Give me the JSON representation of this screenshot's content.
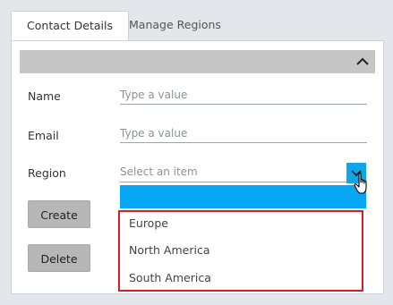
{
  "tabs": [
    {
      "label": "Contact Details",
      "active": true
    },
    {
      "label": "Manage Regions",
      "active": false
    }
  ],
  "form": {
    "name": {
      "label": "Name",
      "placeholder": "Type a value"
    },
    "email": {
      "label": "Email",
      "placeholder": "Type a value"
    },
    "region": {
      "label": "Region",
      "placeholder": "Select an item"
    }
  },
  "buttons": {
    "create": "Create",
    "delete": "Delete"
  },
  "region_options": [
    "Europe",
    "North America",
    "South America"
  ],
  "colors": {
    "highlight_bar": "#08a7f5",
    "options_border": "#d21f2a",
    "header_bar": "#c6c6c6"
  },
  "icons": {
    "collapse": "chevron-up-icon",
    "dropdown": "chevron-down-icon",
    "cursor": "hand-pointer-icon"
  }
}
